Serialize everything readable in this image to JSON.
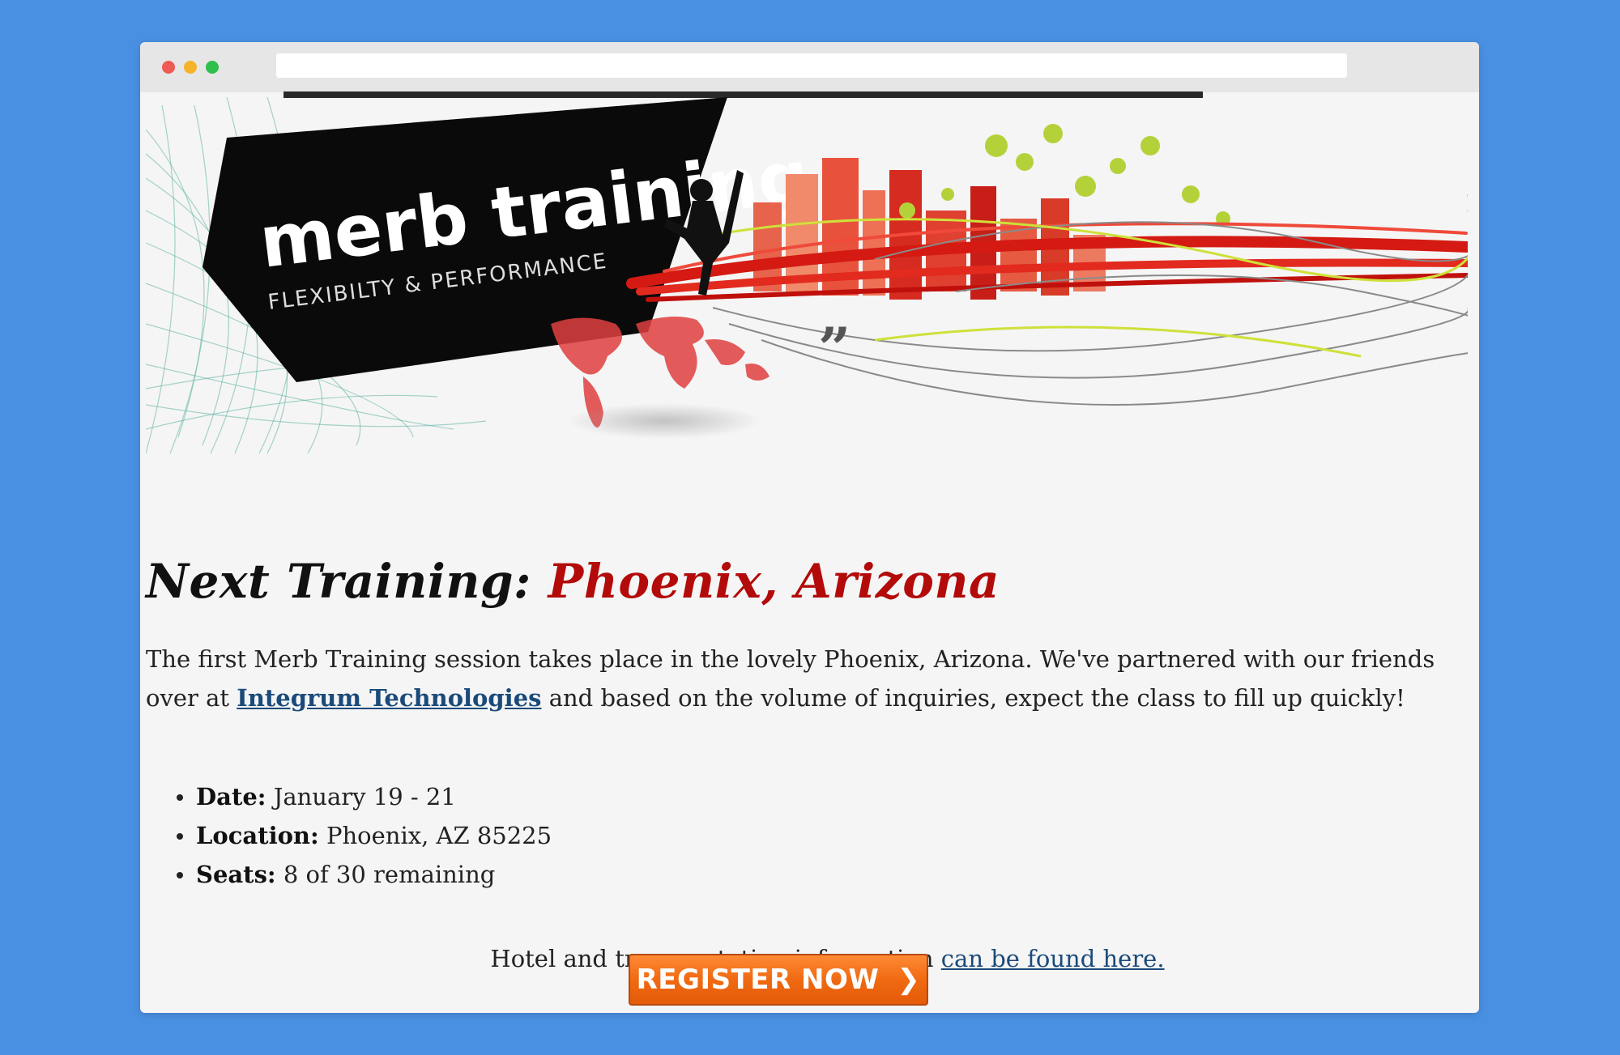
{
  "browser": {
    "url": ""
  },
  "banner": {
    "logo_text": "merb training",
    "tagline": "FLEXIBILTY & PERFORMANCE"
  },
  "heading": {
    "prefix": "Next Training:",
    "city": "Phoenix, Arizona"
  },
  "intro": {
    "text_before": "The first Merb Training session takes place in the lovely Phoenix, Arizona. We've partnered with our friends over at",
    "link_text": "Integrum Technologies",
    "text_after": "and based on the volume of inquiries, expect the class to fill up quickly!"
  },
  "details": [
    {
      "label": "Date:",
      "value": "January 19 - 21"
    },
    {
      "label": "Location:",
      "value": "Phoenix, AZ 85225"
    },
    {
      "label": "Seats:",
      "value": "8 of 30 remaining"
    }
  ],
  "hotel": {
    "text": "Hotel and transportation information",
    "link_text": "can be found here."
  },
  "register_button": {
    "label": "REGISTER NOW",
    "arrow_icon": "chevron-right-icon"
  },
  "colors": {
    "background": "#4a90e2",
    "heading_city": "#b30a0a",
    "link": "#1a4a7a",
    "button": "#f06a12"
  }
}
